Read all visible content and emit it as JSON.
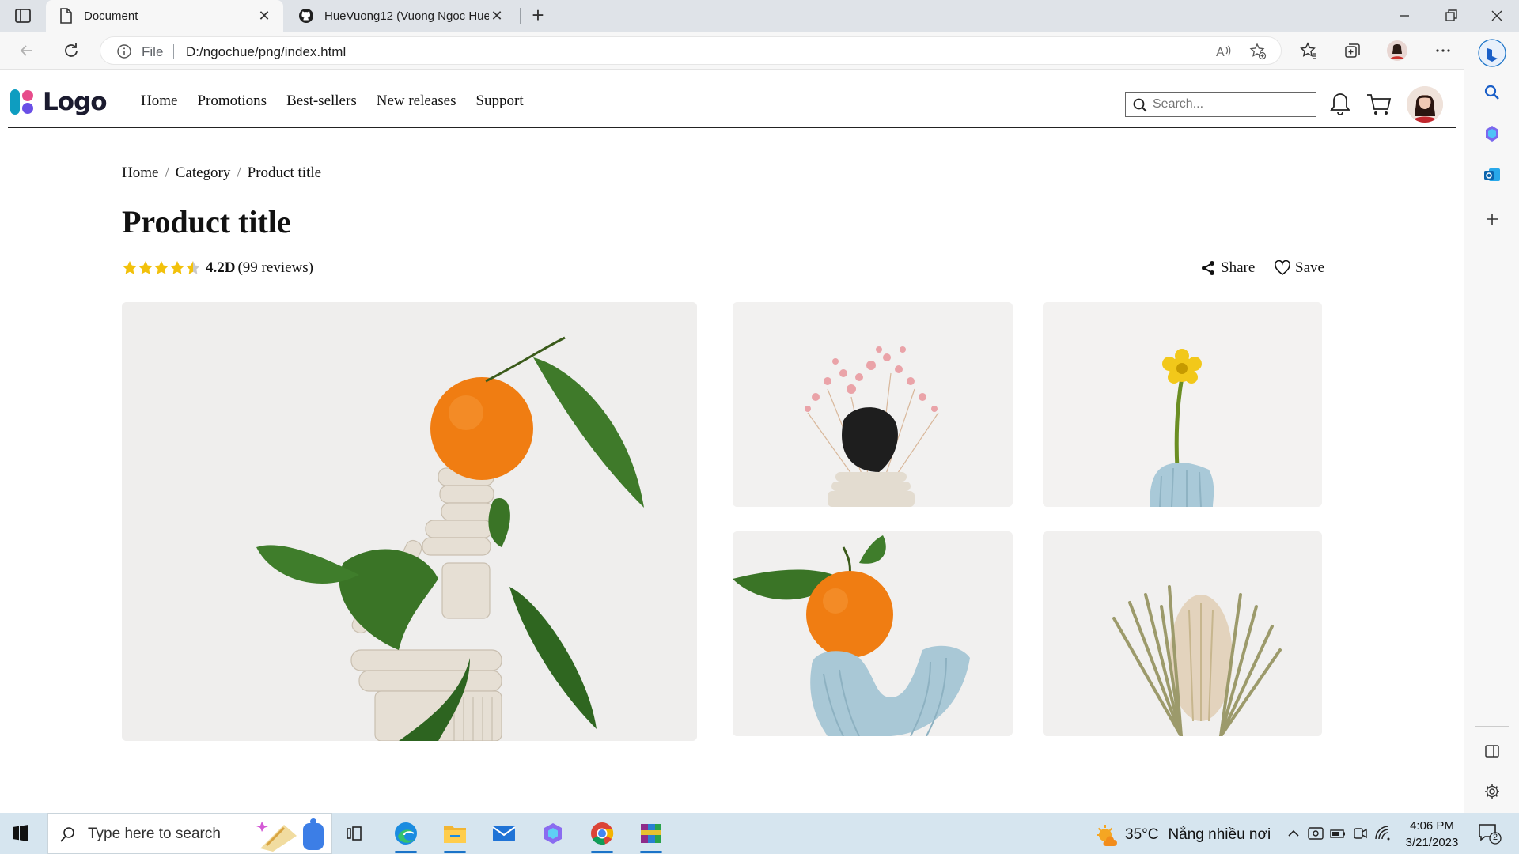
{
  "browser": {
    "tabs": [
      {
        "title": "Document",
        "icon": "document-icon",
        "active": true
      },
      {
        "title": "HueVuong12 (Vuong Ngoc Hue)",
        "icon": "github-icon",
        "active": false
      }
    ],
    "address": {
      "scheme": "File",
      "url": "D:/ngochue/png/index.html"
    }
  },
  "site": {
    "logo_text": "Logo",
    "nav": [
      "Home",
      "Promotions",
      "Best-sellers",
      "New releases",
      "Support"
    ],
    "search_placeholder": "Search..."
  },
  "product": {
    "breadcrumb": [
      "Home",
      "Category",
      "Product title"
    ],
    "title": "Product title",
    "rating": {
      "value_label": "4.2D",
      "count_label": "(99 reviews)",
      "stars": 4.5,
      "max_stars": 5
    },
    "actions": {
      "share": "Share",
      "save": "Save"
    },
    "gallery": [
      {
        "name": "orange-on-clay-tower",
        "description_icon": "main-image"
      },
      {
        "name": "pink-gypsophila",
        "description_icon": "thumb-1"
      },
      {
        "name": "yellow-flower-vase",
        "description_icon": "thumb-2"
      },
      {
        "name": "orange-on-blue-u",
        "description_icon": "thumb-3"
      },
      {
        "name": "banksia-dried",
        "description_icon": "thumb-4"
      }
    ]
  },
  "taskbar": {
    "search_placeholder": "Type here to search",
    "weather": {
      "temp": "35°C",
      "condition": "Nắng nhiều nơi"
    },
    "clock": {
      "time": "4:06 PM",
      "date": "3/21/2023"
    },
    "notifications": "2"
  },
  "colors": {
    "accent_blue": "#1a73c8",
    "star_yellow": "#f2c10b",
    "taskbar": "#d6e5ef"
  }
}
